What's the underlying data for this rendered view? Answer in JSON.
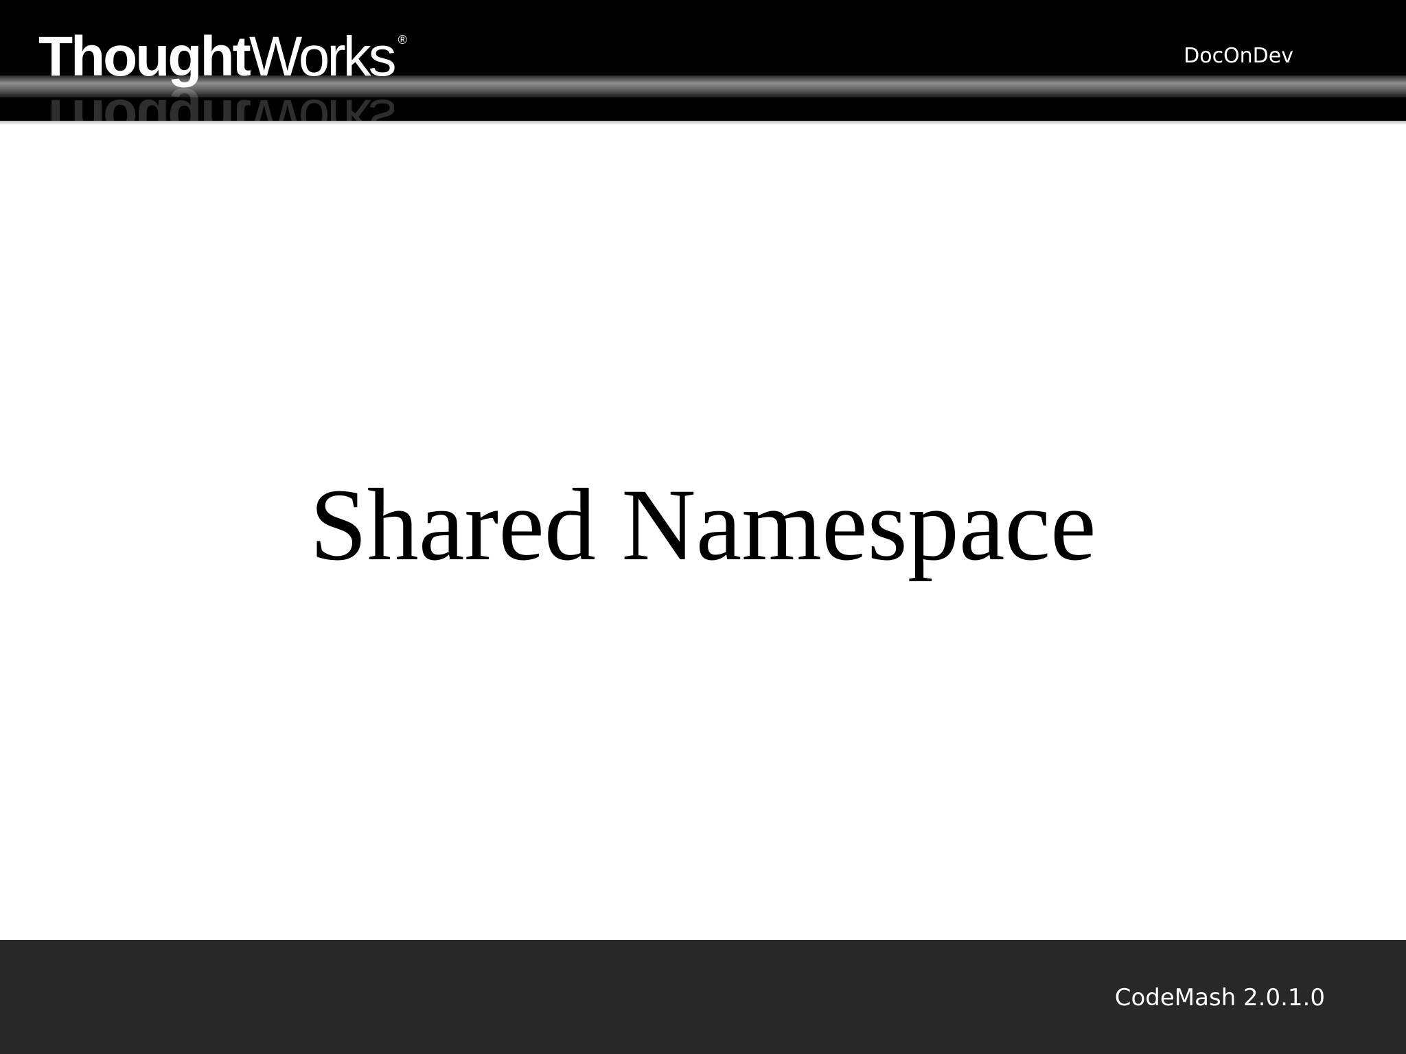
{
  "header": {
    "logo_bold": "Thought",
    "logo_light": "Works",
    "logo_registered": "®",
    "label": "DocOnDev"
  },
  "slide": {
    "title": "Shared Namespace"
  },
  "footer": {
    "label": "CodeMash 2.0.1.0"
  },
  "colors": {
    "header_bg": "#000000",
    "footer_bg": "#282828",
    "slide_bg": "#ffffff",
    "title_text": "#000000",
    "header_text": "#ffffff"
  }
}
